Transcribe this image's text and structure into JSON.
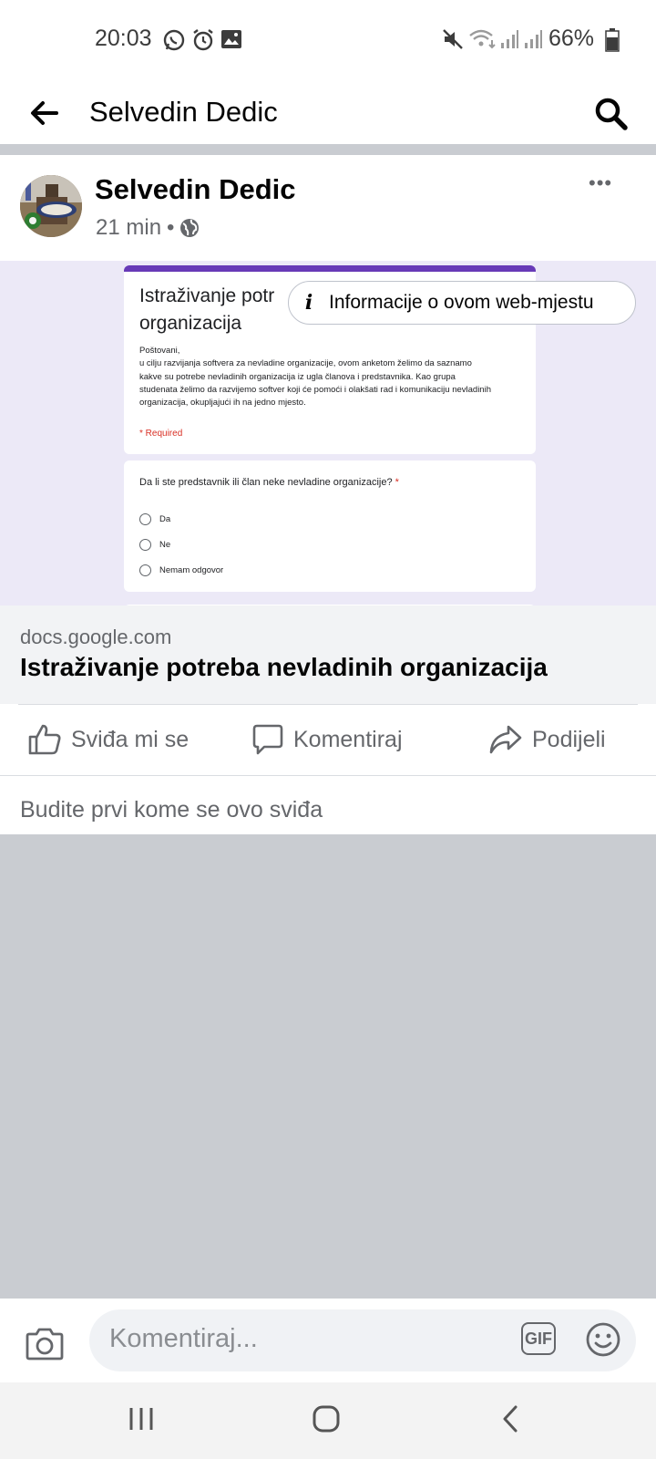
{
  "status": {
    "time": "20:03",
    "battery": "66%"
  },
  "appbar": {
    "title": "Selvedin Dedic"
  },
  "post": {
    "author": "Selvedin Dedic",
    "time": "21 min",
    "separator": "•",
    "more": "•••"
  },
  "preview": {
    "form_title_line1": "Istraživanje potr",
    "form_title_line2": "organizacija",
    "greeting": "Poštovani,",
    "desc_line1": "u cilju razvijanja softvera za nevladine organizacije, ovom anketom želimo da saznamo",
    "desc_line2": "kakve su potrebe nevladinih organizacija iz ugla članova i predstavnika. Kao grupa",
    "desc_line3": "studenata želimo da razvijemo softver koji će pomoći i olakšati rad i komunikaciju nevladinih",
    "desc_line4": "organizacija, okupljajući ih na jedno mjesto.",
    "required": "* Required",
    "question": "Da li ste predstavnik ili član neke nevladine organizacije?",
    "question_star": "*",
    "options": [
      "Da",
      "Ne",
      "Nemam odgovor"
    ],
    "info_pill": "Informacije o ovom web-mjestu"
  },
  "link": {
    "domain": "docs.google.com",
    "title": "Istraživanje potreba nevladinih organizacija"
  },
  "actions": {
    "like": "Sviđa mi se",
    "comment": "Komentiraj",
    "share": "Podijeli"
  },
  "likes_text": "Budite prvi kome se ovo sviđa",
  "comment_box": {
    "placeholder": "Komentiraj...",
    "gif_label": "GIF"
  },
  "colors": {
    "form_accent": "#673ab7",
    "required_red": "#d93025",
    "preview_bg": "#ece9f7"
  }
}
